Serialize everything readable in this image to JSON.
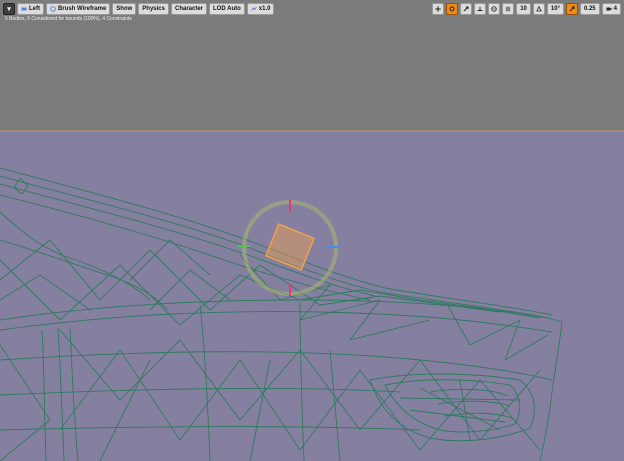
{
  "toolbar_left": {
    "menu_icon": "chevron-down-icon",
    "view_label": "Left",
    "view_icon": "view-mode-icon",
    "brush_wireframe_label": "Brush Wireframe",
    "brush_icon": "wireframe-icon",
    "show_label": "Show",
    "physics_label": "Physics",
    "character_label": "Character",
    "lod_label": "LOD Auto",
    "speed_label": "x1.0",
    "speed_icon": "playback-speed-icon"
  },
  "toolbar_right": {
    "transform_icons": [
      "translate-icon",
      "rotate-icon",
      "scale-icon",
      "surface-snap-icon",
      "world-local-icon",
      "grid-snap-icon"
    ],
    "grid_value": "10",
    "rotation_snap_value": "10°",
    "scale_snap_value": "0.25",
    "camera_speed_value": "4",
    "accent_color": "#f08a12"
  },
  "status": {
    "stats_text": "5 Bodies, 5 Considered for bounds (100%), 4 Constraints"
  },
  "scene": {
    "sky_color": "#7b7b7b",
    "ground_color": "#8680a0",
    "horizon_color": "#c89a6a",
    "wire_color": "#2e7a5e",
    "selection_color": "#f0a050"
  }
}
